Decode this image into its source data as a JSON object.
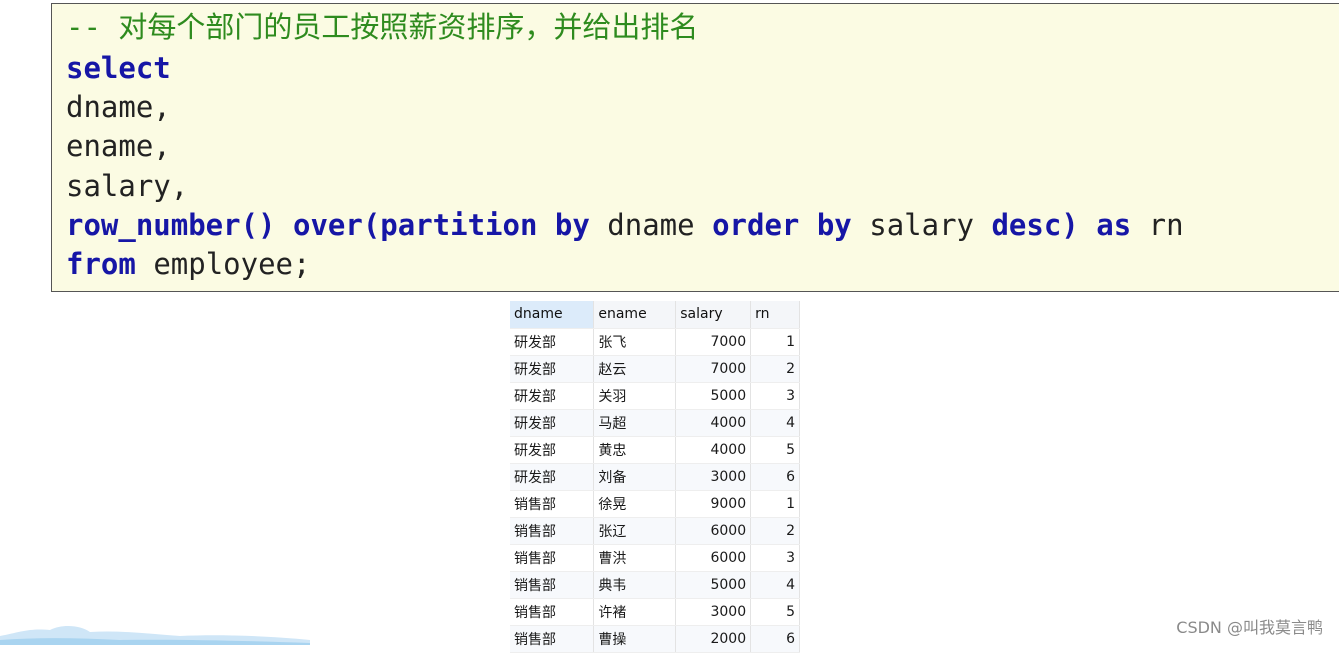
{
  "sql": {
    "comment": "-- 对每个部门的员工按照薪资排序，并给出排名",
    "kw_select": "select",
    "line_dname": "dname,",
    "line_ename": "ename,",
    "line_salary": "salary,",
    "kw_row_number": "row_number()",
    "kw_over_partition": "over(partition",
    "kw_by1": "by",
    "ident_dname": "dname",
    "kw_order": "order",
    "kw_by2": "by",
    "ident_salary": "salary",
    "kw_desc": "desc)",
    "kw_as": "as",
    "ident_rn": "rn",
    "kw_from": "from",
    "ident_table": "employee;"
  },
  "result": {
    "columns": [
      "dname",
      "ename",
      "salary",
      "rn"
    ],
    "rows": [
      [
        "研发部",
        "张飞",
        "7000",
        "1"
      ],
      [
        "研发部",
        "赵云",
        "7000",
        "2"
      ],
      [
        "研发部",
        "关羽",
        "5000",
        "3"
      ],
      [
        "研发部",
        "马超",
        "4000",
        "4"
      ],
      [
        "研发部",
        "黄忠",
        "4000",
        "5"
      ],
      [
        "研发部",
        "刘备",
        "3000",
        "6"
      ],
      [
        "销售部",
        "徐晃",
        "9000",
        "1"
      ],
      [
        "销售部",
        "张辽",
        "6000",
        "2"
      ],
      [
        "销售部",
        "曹洪",
        "6000",
        "3"
      ],
      [
        "销售部",
        "典韦",
        "5000",
        "4"
      ],
      [
        "销售部",
        "许褚",
        "3000",
        "5"
      ],
      [
        "销售部",
        "曹操",
        "2000",
        "6"
      ]
    ]
  },
  "watermark": "CSDN @叫我莫言鸭",
  "colors": {
    "keyword": "#1616a6",
    "comment": "#2e8b1e",
    "code_bg": "#fbfbe3"
  }
}
